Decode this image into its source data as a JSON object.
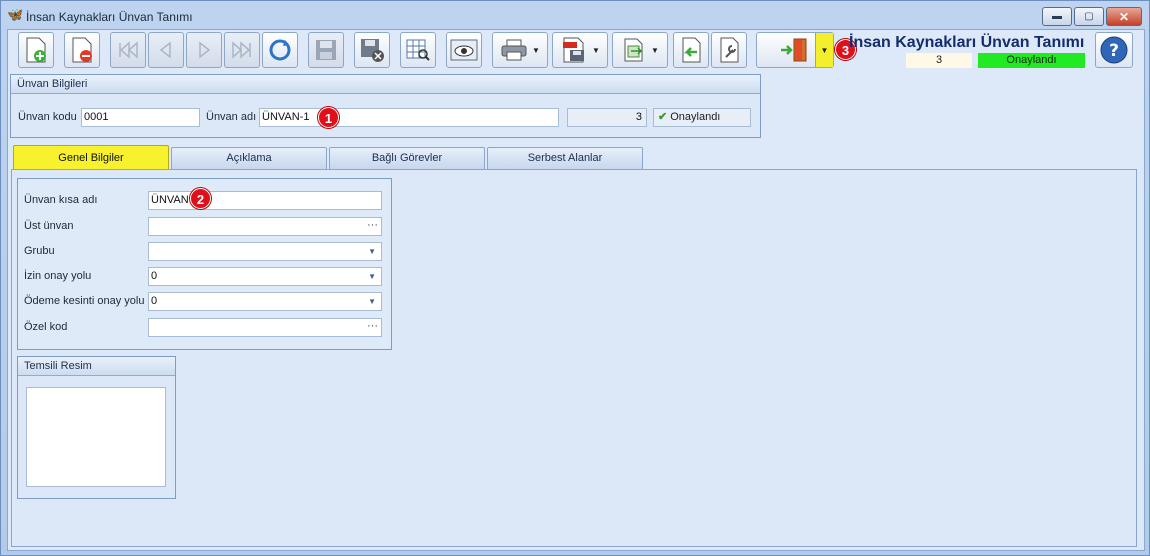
{
  "window": {
    "title": "İnsan Kaynakları Ünvan Tanımı",
    "minimize_symbol": "▬",
    "maximize_symbol": "▢",
    "close_symbol": "✕"
  },
  "toolbar": {
    "buttons": [
      {
        "name": "new-record-button",
        "icon": "new-document-icon"
      },
      {
        "name": "delete-record-button",
        "icon": "delete-document-icon"
      },
      {
        "name": "first-record-button",
        "icon": "first-icon"
      },
      {
        "name": "prev-record-button",
        "icon": "prev-icon"
      },
      {
        "name": "next-record-button",
        "icon": "next-icon"
      },
      {
        "name": "last-record-button",
        "icon": "last-icon"
      },
      {
        "name": "refresh-button",
        "icon": "refresh-icon"
      },
      {
        "name": "save-button",
        "icon": "save-icon"
      },
      {
        "name": "save-close-button",
        "icon": "save-close-icon"
      },
      {
        "name": "preview-button",
        "icon": "preview-icon"
      },
      {
        "name": "view-button",
        "icon": "eye-icon"
      },
      {
        "name": "print-button",
        "icon": "printer-icon"
      },
      {
        "name": "pdf-button",
        "icon": "pdf-icon"
      },
      {
        "name": "export-button",
        "icon": "export-icon"
      },
      {
        "name": "back-button",
        "icon": "back-icon"
      },
      {
        "name": "settings-button",
        "icon": "wrench-icon"
      },
      {
        "name": "exit-button",
        "icon": "exit-door-icon"
      },
      {
        "name": "help-button",
        "icon": "help-icon"
      }
    ]
  },
  "header": {
    "title": "İnsan Kaynakları Ünvan Tanımı",
    "status_number": "3",
    "status_text": "Onaylandı",
    "status_color": "#22ea22"
  },
  "markers": [
    "1",
    "2",
    "3"
  ],
  "unvan_bilgileri": {
    "title": "Ünvan Bilgileri",
    "kod_label": "Ünvan kodu",
    "kod_value": "0001",
    "ad_label": "Ünvan adı",
    "ad_value": "ÜNVAN-1",
    "number_value": "3",
    "approved_label": "Onaylandı"
  },
  "tabs": [
    {
      "label": "Genel Bilgiler",
      "active": true
    },
    {
      "label": "Açıklama",
      "active": false
    },
    {
      "label": "Bağlı Görevler",
      "active": false
    },
    {
      "label": "Serbest Alanlar",
      "active": false
    }
  ],
  "genel_bilgiler": {
    "fields": [
      {
        "label": "Ünvan kısa adı",
        "value": "ÜNVAN"
      },
      {
        "label": "Üst ünvan",
        "value": ""
      },
      {
        "label": "Grubu",
        "value": ""
      },
      {
        "label": "İzin onay yolu",
        "value": "0"
      },
      {
        "label": "Ödeme kesinti onay yolu",
        "value": "0"
      },
      {
        "label": "Özel kod",
        "value": ""
      }
    ]
  },
  "temsili_resim": {
    "title": "Temsili Resim"
  }
}
